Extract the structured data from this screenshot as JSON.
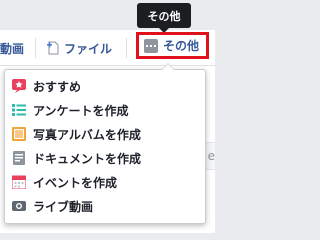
{
  "composer": {
    "left_item_label": "動画",
    "file_label": "ファイル",
    "more_label": "その他",
    "field_placeholder": "e"
  },
  "tooltip": {
    "text": "その他"
  },
  "menu": {
    "items": [
      {
        "label": "おすすめ",
        "icon": "recommend-star-icon",
        "color": "#e9405f"
      },
      {
        "label": "アンケートを作成",
        "icon": "poll-list-icon",
        "color": "#2bbcaa"
      },
      {
        "label": "写真アルバムを作成",
        "icon": "photo-album-icon",
        "color": "#f5a43b"
      },
      {
        "label": "ドキュメントを作成",
        "icon": "document-icon",
        "color": "#8d949e"
      },
      {
        "label": "イベントを作成",
        "icon": "event-calendar-icon",
        "color": "#e9405f"
      },
      {
        "label": "ライブ動画",
        "icon": "live-video-camera-icon",
        "color": "#606770"
      }
    ]
  },
  "colors": {
    "link_blue": "#365899",
    "highlight_red": "#e0111a",
    "tooltip_bg": "#1c1e21"
  }
}
